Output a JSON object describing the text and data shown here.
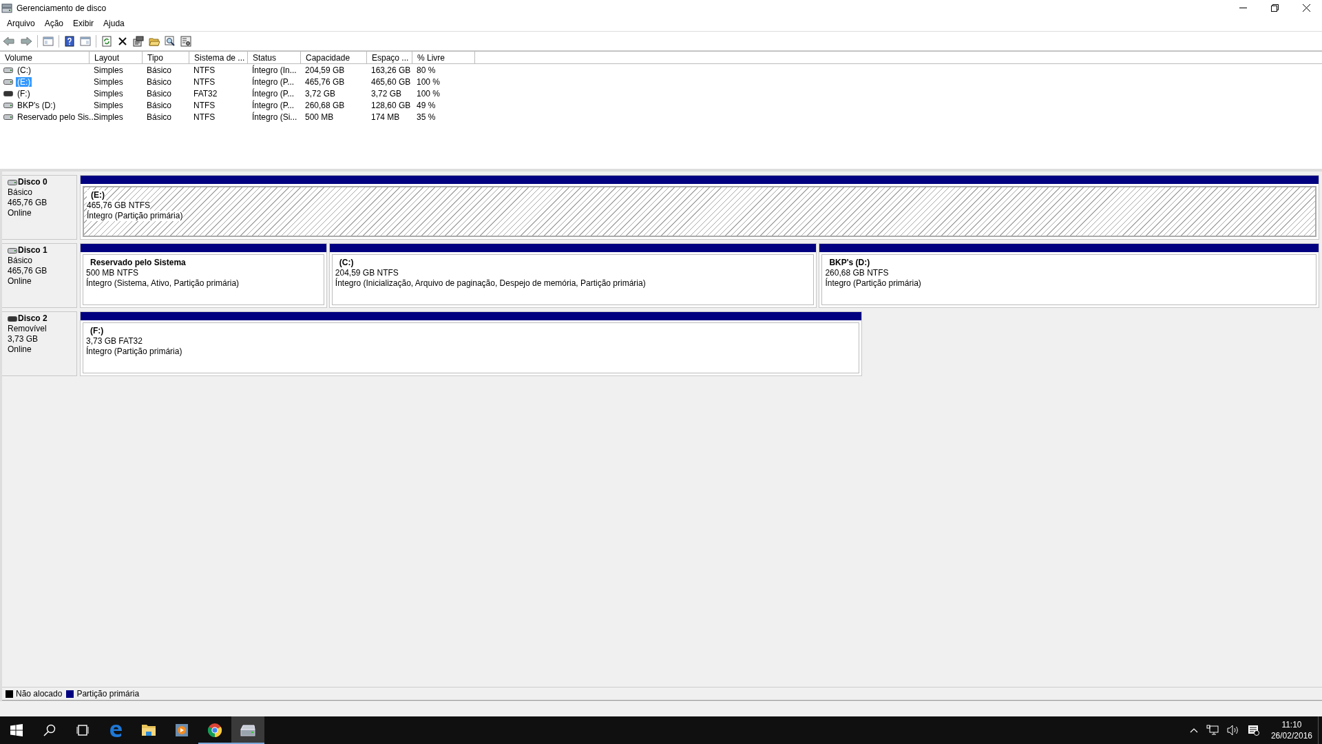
{
  "window": {
    "title": "Gerenciamento de disco"
  },
  "menu": [
    "Arquivo",
    "Ação",
    "Exibir",
    "Ajuda"
  ],
  "table": {
    "columns": [
      "Volume",
      "Layout",
      "Tipo",
      "Sistema de ...",
      "Status",
      "Capacidade",
      "Espaço ...",
      "% Livre"
    ],
    "rows": [
      {
        "kind": "fixed",
        "selected": false,
        "cells": [
          "(C:)",
          "Simples",
          "Básico",
          "NTFS",
          "Íntegro (In...",
          "204,59 GB",
          "163,26 GB",
          "80 %"
        ]
      },
      {
        "kind": "fixed",
        "selected": true,
        "cells": [
          "(E:)",
          "Simples",
          "Básico",
          "NTFS",
          "Íntegro (P...",
          "465,76 GB",
          "465,60 GB",
          "100 %"
        ]
      },
      {
        "kind": "removable",
        "selected": false,
        "cells": [
          "(F:)",
          "Simples",
          "Básico",
          "FAT32",
          "Íntegro (P...",
          "3,72 GB",
          "3,72 GB",
          "100 %"
        ]
      },
      {
        "kind": "fixed",
        "selected": false,
        "cells": [
          "BKP's (D:)",
          "Simples",
          "Básico",
          "NTFS",
          "Íntegro (P...",
          "260,68 GB",
          "128,60 GB",
          "49 %"
        ]
      },
      {
        "kind": "fixed",
        "selected": false,
        "cells": [
          "Reservado pelo Sis...",
          "Simples",
          "Básico",
          "NTFS",
          "Íntegro (Si...",
          "500 MB",
          "174 MB",
          "35 %"
        ]
      }
    ]
  },
  "disks": [
    {
      "name": "Disco 0",
      "kind": "fixed",
      "type": "Básico",
      "size": "465,76 GB",
      "status": "Online",
      "partitions": [
        {
          "name": "(E:)",
          "detail": "465,76 GB NTFS",
          "status": "Íntegro (Partição primária)",
          "selected": true
        }
      ]
    },
    {
      "name": "Disco 1",
      "kind": "fixed",
      "type": "Básico",
      "size": "465,76 GB",
      "status": "Online",
      "partitions": [
        {
          "name": "Reservado pelo Sistema",
          "detail": "500 MB NTFS",
          "status": "Íntegro (Sistema, Ativo, Partição primária)",
          "selected": false
        },
        {
          "name": "(C:)",
          "detail": "204,59 GB NTFS",
          "status": "Íntegro (Inicialização, Arquivo de paginação, Despejo de memória, Partição primária)",
          "selected": false
        },
        {
          "name": "BKP's  (D:)",
          "detail": "260,68 GB NTFS",
          "status": "Íntegro (Partição primária)",
          "selected": false
        }
      ]
    },
    {
      "name": "Disco 2",
      "kind": "removable",
      "type": "Removível",
      "size": "3,73 GB",
      "status": "Online",
      "partitions": [
        {
          "name": "(F:)",
          "detail": "3,73 GB FAT32",
          "status": "Íntegro (Partição primária)",
          "selected": false
        }
      ]
    }
  ],
  "legend": [
    {
      "label": "Não alocado",
      "color": "#000000"
    },
    {
      "label": "Partição primária",
      "color": "#000080"
    }
  ],
  "taskbar": {
    "apps": [
      {
        "kind": "edge",
        "running": false,
        "selected": false
      },
      {
        "kind": "explorer",
        "running": false,
        "selected": false
      },
      {
        "kind": "media",
        "running": false,
        "selected": false
      },
      {
        "kind": "chrome",
        "running": true,
        "selected": false
      },
      {
        "kind": "disk",
        "running": true,
        "selected": true
      }
    ],
    "time": "11:10",
    "date": "26/02/2016"
  }
}
